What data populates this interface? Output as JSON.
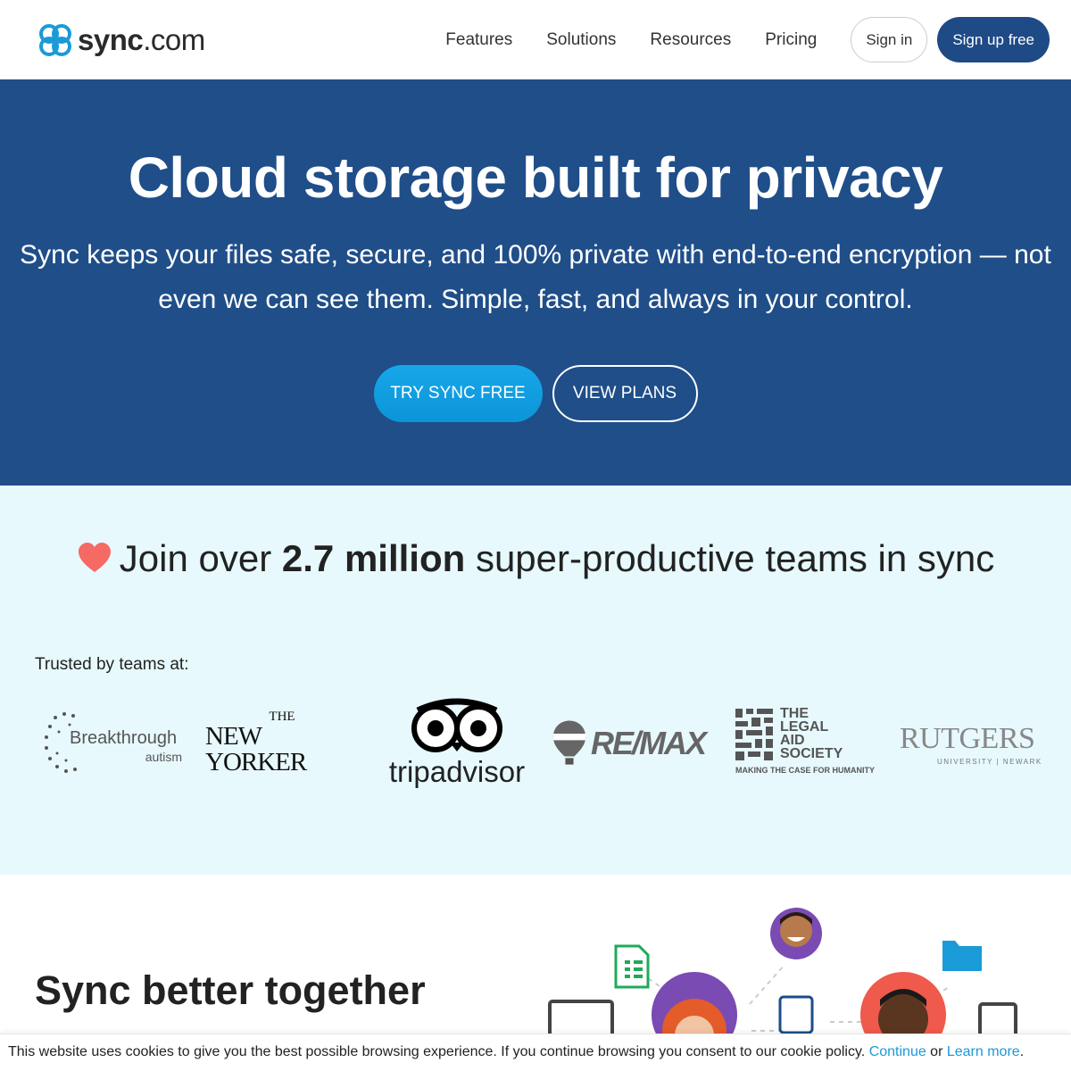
{
  "header": {
    "logo_bold": "sync",
    "logo_light": ".com",
    "nav": [
      "Features",
      "Solutions",
      "Resources",
      "Pricing"
    ],
    "signin": "Sign in",
    "signup": "Sign up free"
  },
  "hero": {
    "title": "Cloud storage built for privacy",
    "subtitle": "Sync keeps your files safe, secure, and 100% private with end-to-end encryption — not even we can see them. Simple, fast, and always in your control.",
    "try_button": "TRY SYNC FREE",
    "plans_button": "VIEW PLANS"
  },
  "trust": {
    "heading_pre": "Join over ",
    "heading_bold": "2.7 million",
    "heading_post": " super-productive teams in sync",
    "trusted_label": "Trusted by teams at:",
    "logos": {
      "breakthrough": "Breakthrough",
      "breakthrough_sub": "autism",
      "newyorker_the": "THE",
      "newyorker": "NEW YORKER",
      "tripadvisor": "tripadvisor",
      "remax": "RE/MAX",
      "legal_aid_1": "THE",
      "legal_aid_2": "LEGAL",
      "legal_aid_3": "AID",
      "legal_aid_4": "SOCIETY",
      "legal_aid_tag": "MAKING THE CASE FOR HUMANITY",
      "rutgers": "RUTGERS",
      "rutgers_sub": "UNIVERSITY | NEWARK"
    }
  },
  "better": {
    "title": "Sync better together"
  },
  "cookie": {
    "text": "This website uses cookies to give you the best possible browsing experience. If you continue browsing you consent to our cookie policy. ",
    "continue": "Continue",
    "or": " or ",
    "learn_more": "Learn more",
    "period": "."
  },
  "colors": {
    "brand_blue": "#1f4e89",
    "accent_cyan": "#0c95d8",
    "trust_bg": "#e7f9fd",
    "heart": "#f56a63"
  }
}
